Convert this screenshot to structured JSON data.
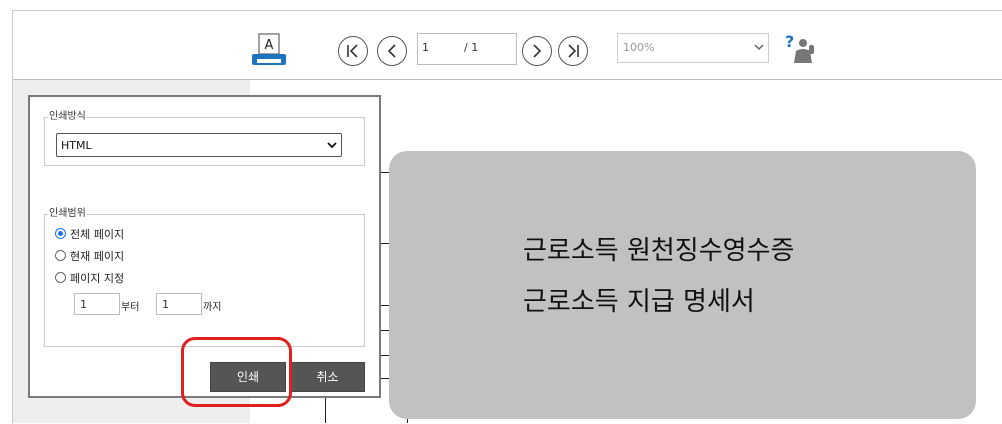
{
  "toolbar": {
    "print_icon": "printer-icon",
    "print_icon_letter": "A",
    "nav_icons": [
      "first-page-icon",
      "prev-page-icon",
      "next-page-icon",
      "last-page-icon"
    ],
    "current_page": "1",
    "total_pages": "/ 1",
    "zoom": "100%",
    "help_icon": "help-person-icon"
  },
  "dialog": {
    "print_method": {
      "legend": "인쇄방식",
      "selected": "HTML"
    },
    "print_range": {
      "legend": "인쇄범위",
      "options": [
        {
          "label": "전체 페이지",
          "checked": true
        },
        {
          "label": "현재 페이지",
          "checked": false
        },
        {
          "label": "페이지 지정",
          "checked": false
        }
      ],
      "from_value": "1",
      "from_label": "부터",
      "to_value": "1",
      "to_label": "까지"
    },
    "print_button": "인쇄",
    "cancel_button": "취소"
  },
  "overlay": {
    "lines": [
      "근로소득 원천징수영수증",
      "근로소득 지급 명세서"
    ]
  },
  "colors": {
    "accent_blue": "#1a73e8",
    "highlight_red": "#e02020",
    "button_dark": "#555555",
    "overlay_gray": "#c1c1c1"
  }
}
